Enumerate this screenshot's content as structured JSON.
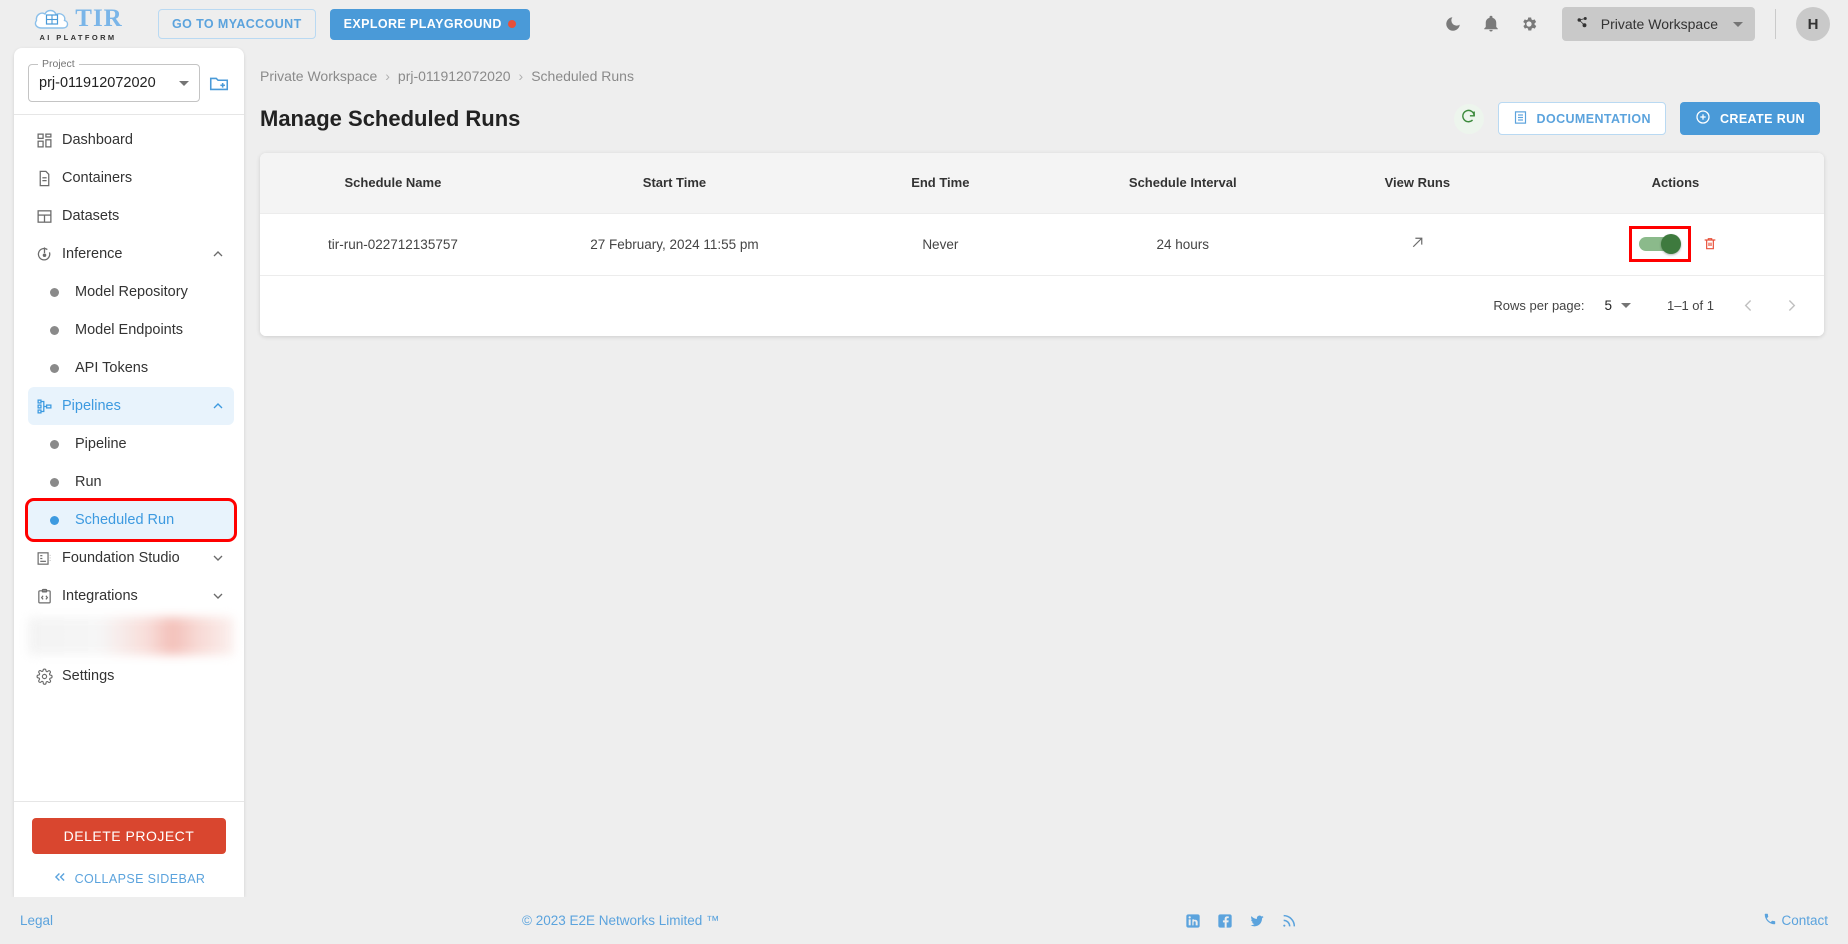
{
  "topbar": {
    "logo_text": "TIR",
    "logo_sub": "AI PLATFORM",
    "myaccount_label": "GO TO MYACCOUNT",
    "playground_label": "EXPLORE PLAYGROUND",
    "workspace_label": "Private Workspace",
    "avatar_initial": "H",
    "icons": [
      "dark-mode-icon",
      "notifications-icon",
      "settings-icon"
    ]
  },
  "sidebar": {
    "project_label": "Project",
    "project_value": "prj-011912072020",
    "items": [
      {
        "label": "Dashboard",
        "icon": "dashboard-icon",
        "type": "item"
      },
      {
        "label": "Containers",
        "icon": "containers-icon",
        "type": "item"
      },
      {
        "label": "Datasets",
        "icon": "datasets-icon",
        "type": "item"
      },
      {
        "label": "Inference",
        "icon": "inference-icon",
        "type": "group",
        "expanded": true
      },
      {
        "label": "Model Repository",
        "type": "sub"
      },
      {
        "label": "Model Endpoints",
        "type": "sub"
      },
      {
        "label": "API Tokens",
        "type": "sub"
      },
      {
        "label": "Pipelines",
        "icon": "pipelines-icon",
        "type": "group",
        "expanded": true,
        "active": true
      },
      {
        "label": "Pipeline",
        "type": "sub"
      },
      {
        "label": "Run",
        "type": "sub"
      },
      {
        "label": "Scheduled Run",
        "type": "sub",
        "active": true,
        "highlighted": true
      },
      {
        "label": "Foundation Studio",
        "icon": "foundation-studio-icon",
        "type": "group",
        "expanded": false
      },
      {
        "label": "Integrations",
        "icon": "integrations-icon",
        "type": "group",
        "expanded": false
      },
      {
        "label": "Settings",
        "icon": "gear-icon",
        "type": "item"
      }
    ],
    "delete_project_label": "DELETE PROJECT",
    "collapse_label": "COLLAPSE SIDEBAR"
  },
  "main": {
    "breadcrumb": [
      "Private Workspace",
      "prj-011912072020",
      "Scheduled Runs"
    ],
    "breadcrumb_separator": "›",
    "page_title": "Manage Scheduled Runs",
    "refresh_label": "refresh-icon",
    "documentation_label": "DOCUMENTATION",
    "create_run_label": "CREATE RUN"
  },
  "table": {
    "columns": [
      "Schedule Name",
      "Start Time",
      "End Time",
      "Schedule Interval",
      "View Runs",
      "Actions"
    ],
    "rows": [
      {
        "schedule_name": "tir-run-022712135757",
        "start_time": "27 February, 2024 11:55 pm",
        "end_time": "Never",
        "schedule_interval": "24 hours",
        "view_runs": "external-link-icon",
        "enabled": true
      }
    ]
  },
  "pagination": {
    "rows_per_page_label": "Rows per page:",
    "rows_per_page_value": "5",
    "range_label": "1–1 of 1",
    "prev_label": "‹",
    "next_label": "›"
  },
  "footer": {
    "legal": "Legal",
    "copyright": "© 2023 E2E Networks Limited ™",
    "contact": "Contact",
    "social": [
      "linkedin-icon",
      "facebook-icon",
      "twitter-icon",
      "rss-icon"
    ]
  },
  "colors": {
    "accent_blue": "#4a9ad8",
    "link_blue": "#5ba3dd",
    "danger_red": "#d9462f",
    "toggle_green": "#3e7a3e",
    "highlight_red": "#ff0000",
    "page_bg": "#eeeeee"
  }
}
